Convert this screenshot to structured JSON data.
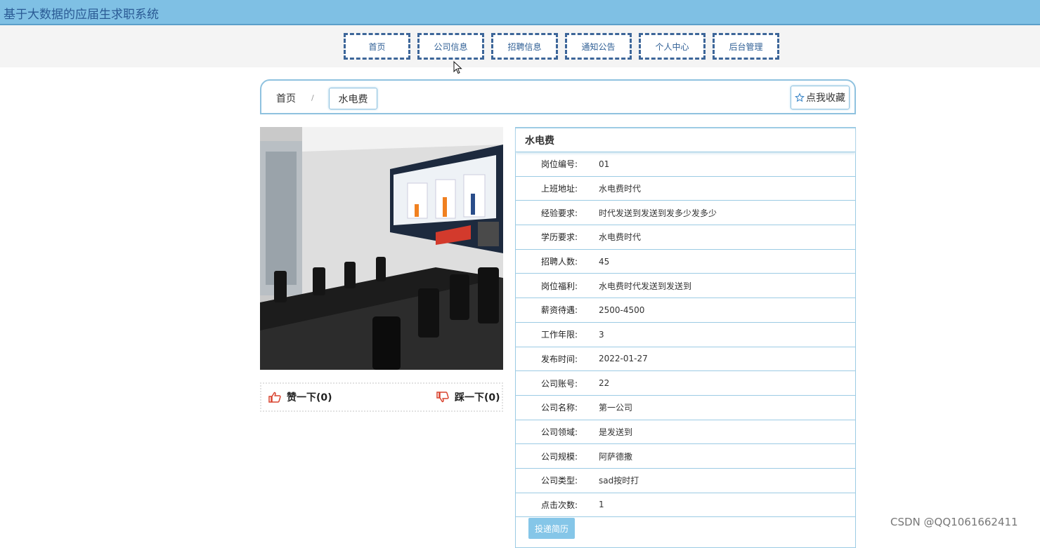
{
  "header": {
    "title": "基于大数据的应届生求职系统"
  },
  "nav": {
    "items": [
      {
        "label": "首页"
      },
      {
        "label": "公司信息"
      },
      {
        "label": "招聘信息"
      },
      {
        "label": "通知公告"
      },
      {
        "label": "个人中心"
      },
      {
        "label": "后台管理"
      }
    ]
  },
  "breadcrumb": {
    "home": "首页",
    "separator": "/",
    "current": "水电费"
  },
  "favorite": {
    "icon": "star-outline-icon",
    "label": "点我收藏"
  },
  "votes": {
    "like": {
      "icon": "thumbs-up-icon",
      "label": "赞一下(0)"
    },
    "dislike": {
      "icon": "thumbs-down-icon",
      "label": "踩一下(0)"
    }
  },
  "details": {
    "title": "水电费",
    "fields": [
      {
        "label": "岗位编号:",
        "value": "01"
      },
      {
        "label": "上班地址:",
        "value": "水电费时代"
      },
      {
        "label": "经验要求:",
        "value": "时代发送到发送到发多少发多少"
      },
      {
        "label": "学历要求:",
        "value": "水电费时代"
      },
      {
        "label": "招聘人数:",
        "value": "45"
      },
      {
        "label": "岗位福利:",
        "value": "水电费时代发送到发送到"
      },
      {
        "label": "薪资待遇:",
        "value": "2500-4500"
      },
      {
        "label": "工作年限:",
        "value": "3"
      },
      {
        "label": "发布时间:",
        "value": "2022-01-27"
      },
      {
        "label": "公司账号:",
        "value": "22"
      },
      {
        "label": "公司名称:",
        "value": "第一公司"
      },
      {
        "label": "公司领域:",
        "value": "是发送到"
      },
      {
        "label": "公司规模:",
        "value": "阿萨德撒"
      },
      {
        "label": "公司类型:",
        "value": "sad按时打"
      },
      {
        "label": "点击次数:",
        "value": "1"
      }
    ],
    "apply_label": "投递简历"
  },
  "watermark": "CSDN @QQ1061662411",
  "colors": {
    "header_bg": "#7fc0e4",
    "nav_border": "#3d6699",
    "accent_border": "#9ccbe4",
    "vote_icon": "#d9432f"
  }
}
